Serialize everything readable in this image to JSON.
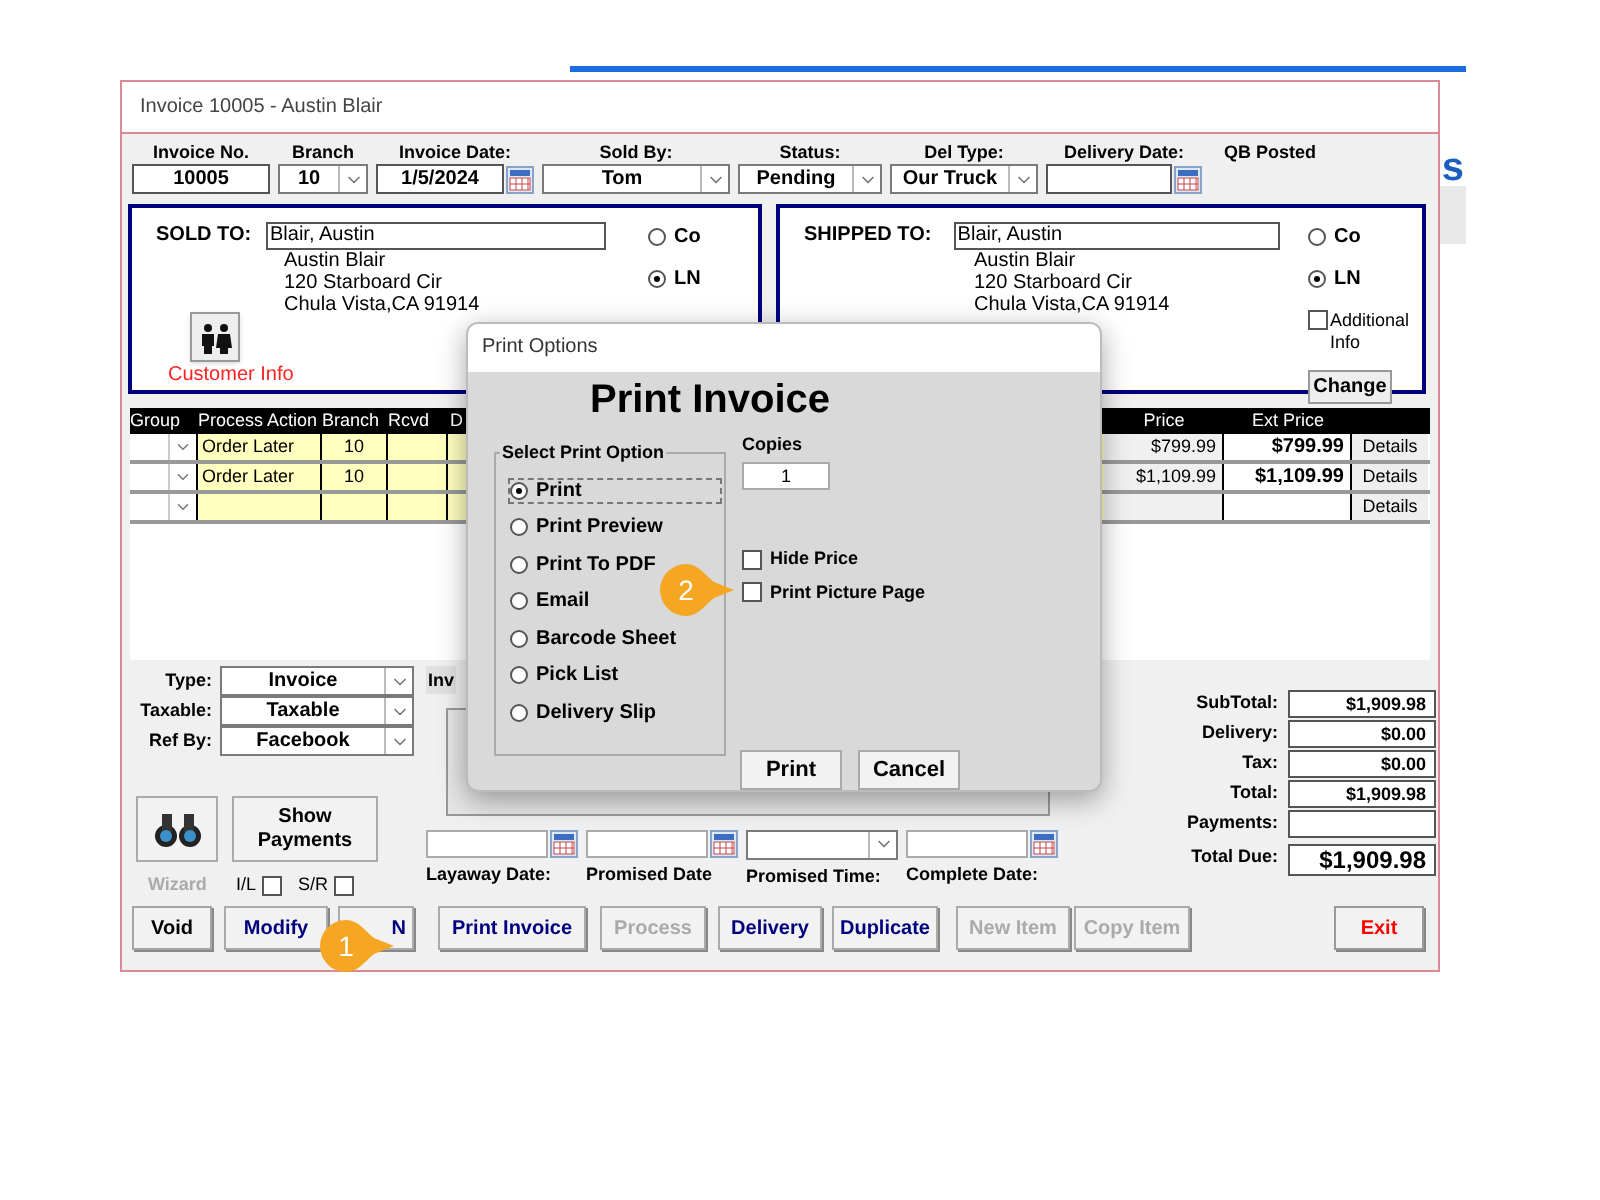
{
  "background": {
    "text": "s"
  },
  "window": {
    "title": "Invoice 10005 - Austin Blair"
  },
  "header_fields": [
    {
      "label": "Invoice No.",
      "value": "10005",
      "kind": "text"
    },
    {
      "label": "Branch",
      "value": "10",
      "kind": "dropdown"
    },
    {
      "label": "Invoice Date:",
      "value": "1/5/2024",
      "kind": "date"
    },
    {
      "label": "Sold By:",
      "value": "Tom",
      "kind": "dropdown"
    },
    {
      "label": "Status:",
      "value": "Pending",
      "kind": "dropdown"
    },
    {
      "label": "Del Type:",
      "value": "Our Truck",
      "kind": "dropdown"
    },
    {
      "label": "Delivery Date:",
      "kind": "date"
    },
    {
      "label": "QB Posted",
      "kind": "label"
    }
  ],
  "sold_to": {
    "label": "SOLD TO:",
    "name": "Blair, Austin",
    "address": [
      "Austin Blair",
      "120 Starboard Cir",
      "Chula Vista,CA 91914"
    ],
    "options": [
      {
        "label": "Co",
        "selected": false
      },
      {
        "label": "LN",
        "selected": true
      }
    ],
    "customer_info": "Customer Info"
  },
  "shipped_to": {
    "label": "SHIPPED TO:",
    "name": "Blair, Austin",
    "address": [
      "Austin Blair",
      "120 Starboard Cir",
      "Chula Vista,CA 91914"
    ],
    "options": [
      {
        "label": "Co",
        "selected": false
      },
      {
        "label": "LN",
        "selected": true
      }
    ],
    "additional_info": {
      "label": "Additional Info",
      "checked": false
    },
    "change_button": "Change"
  },
  "table": {
    "columns": [
      "Group",
      "Process Action",
      "Branch",
      "Rcvd",
      "D",
      "Price",
      "Ext Price"
    ],
    "rows": [
      {
        "process_action": "Order Later",
        "branch": "10",
        "price": "$799.99",
        "ext_price": "$799.99",
        "details": "Details"
      },
      {
        "process_action": "Order Later",
        "branch": "10",
        "price": "$1,109.99",
        "ext_price": "$1,109.99",
        "details": "Details"
      },
      {
        "details": "Details"
      }
    ]
  },
  "lower_left": {
    "fields": [
      {
        "label": "Type:",
        "value": "Invoice"
      },
      {
        "label": "Taxable:",
        "value": "Taxable"
      },
      {
        "label": "Ref By:",
        "value": "Facebook"
      }
    ],
    "wizard": "Wizard",
    "show_payments": "Show Payments",
    "checkboxes": [
      {
        "label": "I/L",
        "checked": false
      },
      {
        "label": "S/R",
        "checked": false
      }
    ]
  },
  "tab_label": "Inv",
  "date_fields": [
    {
      "label": "Layaway Date:",
      "kind": "date"
    },
    {
      "label": "Promised Date",
      "kind": "date"
    },
    {
      "label": "Promised Time:",
      "kind": "dropdown"
    },
    {
      "label": "Complete Date:",
      "kind": "date"
    }
  ],
  "totals": [
    {
      "label": "SubTotal:",
      "value": "$1,909.98",
      "kind": "line"
    },
    {
      "label": "Delivery:",
      "value": "$0.00",
      "kind": "line"
    },
    {
      "label": "Tax:",
      "value": "$0.00",
      "kind": "line"
    },
    {
      "label": "Total:",
      "value": "$1,909.98",
      "kind": "line"
    },
    {
      "label": "Payments:",
      "kind": "line"
    },
    {
      "label": "Total Due:",
      "value": "$1,909.98",
      "kind": "grand"
    }
  ],
  "buttons": [
    {
      "label": "Void",
      "kind": "plain",
      "disabled": false
    },
    {
      "label": "Modify",
      "kind": "action",
      "disabled": false
    },
    {
      "label": "N",
      "kind": "action",
      "disabled": false
    },
    {
      "label": "Print Invoice",
      "kind": "action",
      "disabled": false
    },
    {
      "label": "Process",
      "kind": "action",
      "disabled": true
    },
    {
      "label": "Delivery",
      "kind": "action",
      "disabled": false
    },
    {
      "label": "Duplicate",
      "kind": "action",
      "disabled": false
    },
    {
      "label": "New Item",
      "kind": "action",
      "disabled": true
    },
    {
      "label": "Copy Item",
      "kind": "action",
      "disabled": true
    },
    {
      "label": "Exit",
      "kind": "exit",
      "disabled": false
    }
  ],
  "dialog": {
    "title": "Print Options",
    "heading": "Print Invoice",
    "group_label": "Select Print Option",
    "options": [
      {
        "label": "Print",
        "selected": true
      },
      {
        "label": "Print Preview",
        "selected": false
      },
      {
        "label": "Print To PDF",
        "selected": false
      },
      {
        "label": "Email",
        "selected": false
      },
      {
        "label": "Barcode Sheet",
        "selected": false
      },
      {
        "label": "Pick List",
        "selected": false
      },
      {
        "label": "Delivery Slip",
        "selected": false
      }
    ],
    "copies_label": "Copies",
    "copies": "1",
    "checkboxes": [
      {
        "label": "Hide Price",
        "checked": false
      },
      {
        "label": "Print Picture Page",
        "checked": false
      }
    ],
    "buttons": [
      "Print",
      "Cancel"
    ]
  },
  "callouts": [
    "1",
    "2"
  ]
}
